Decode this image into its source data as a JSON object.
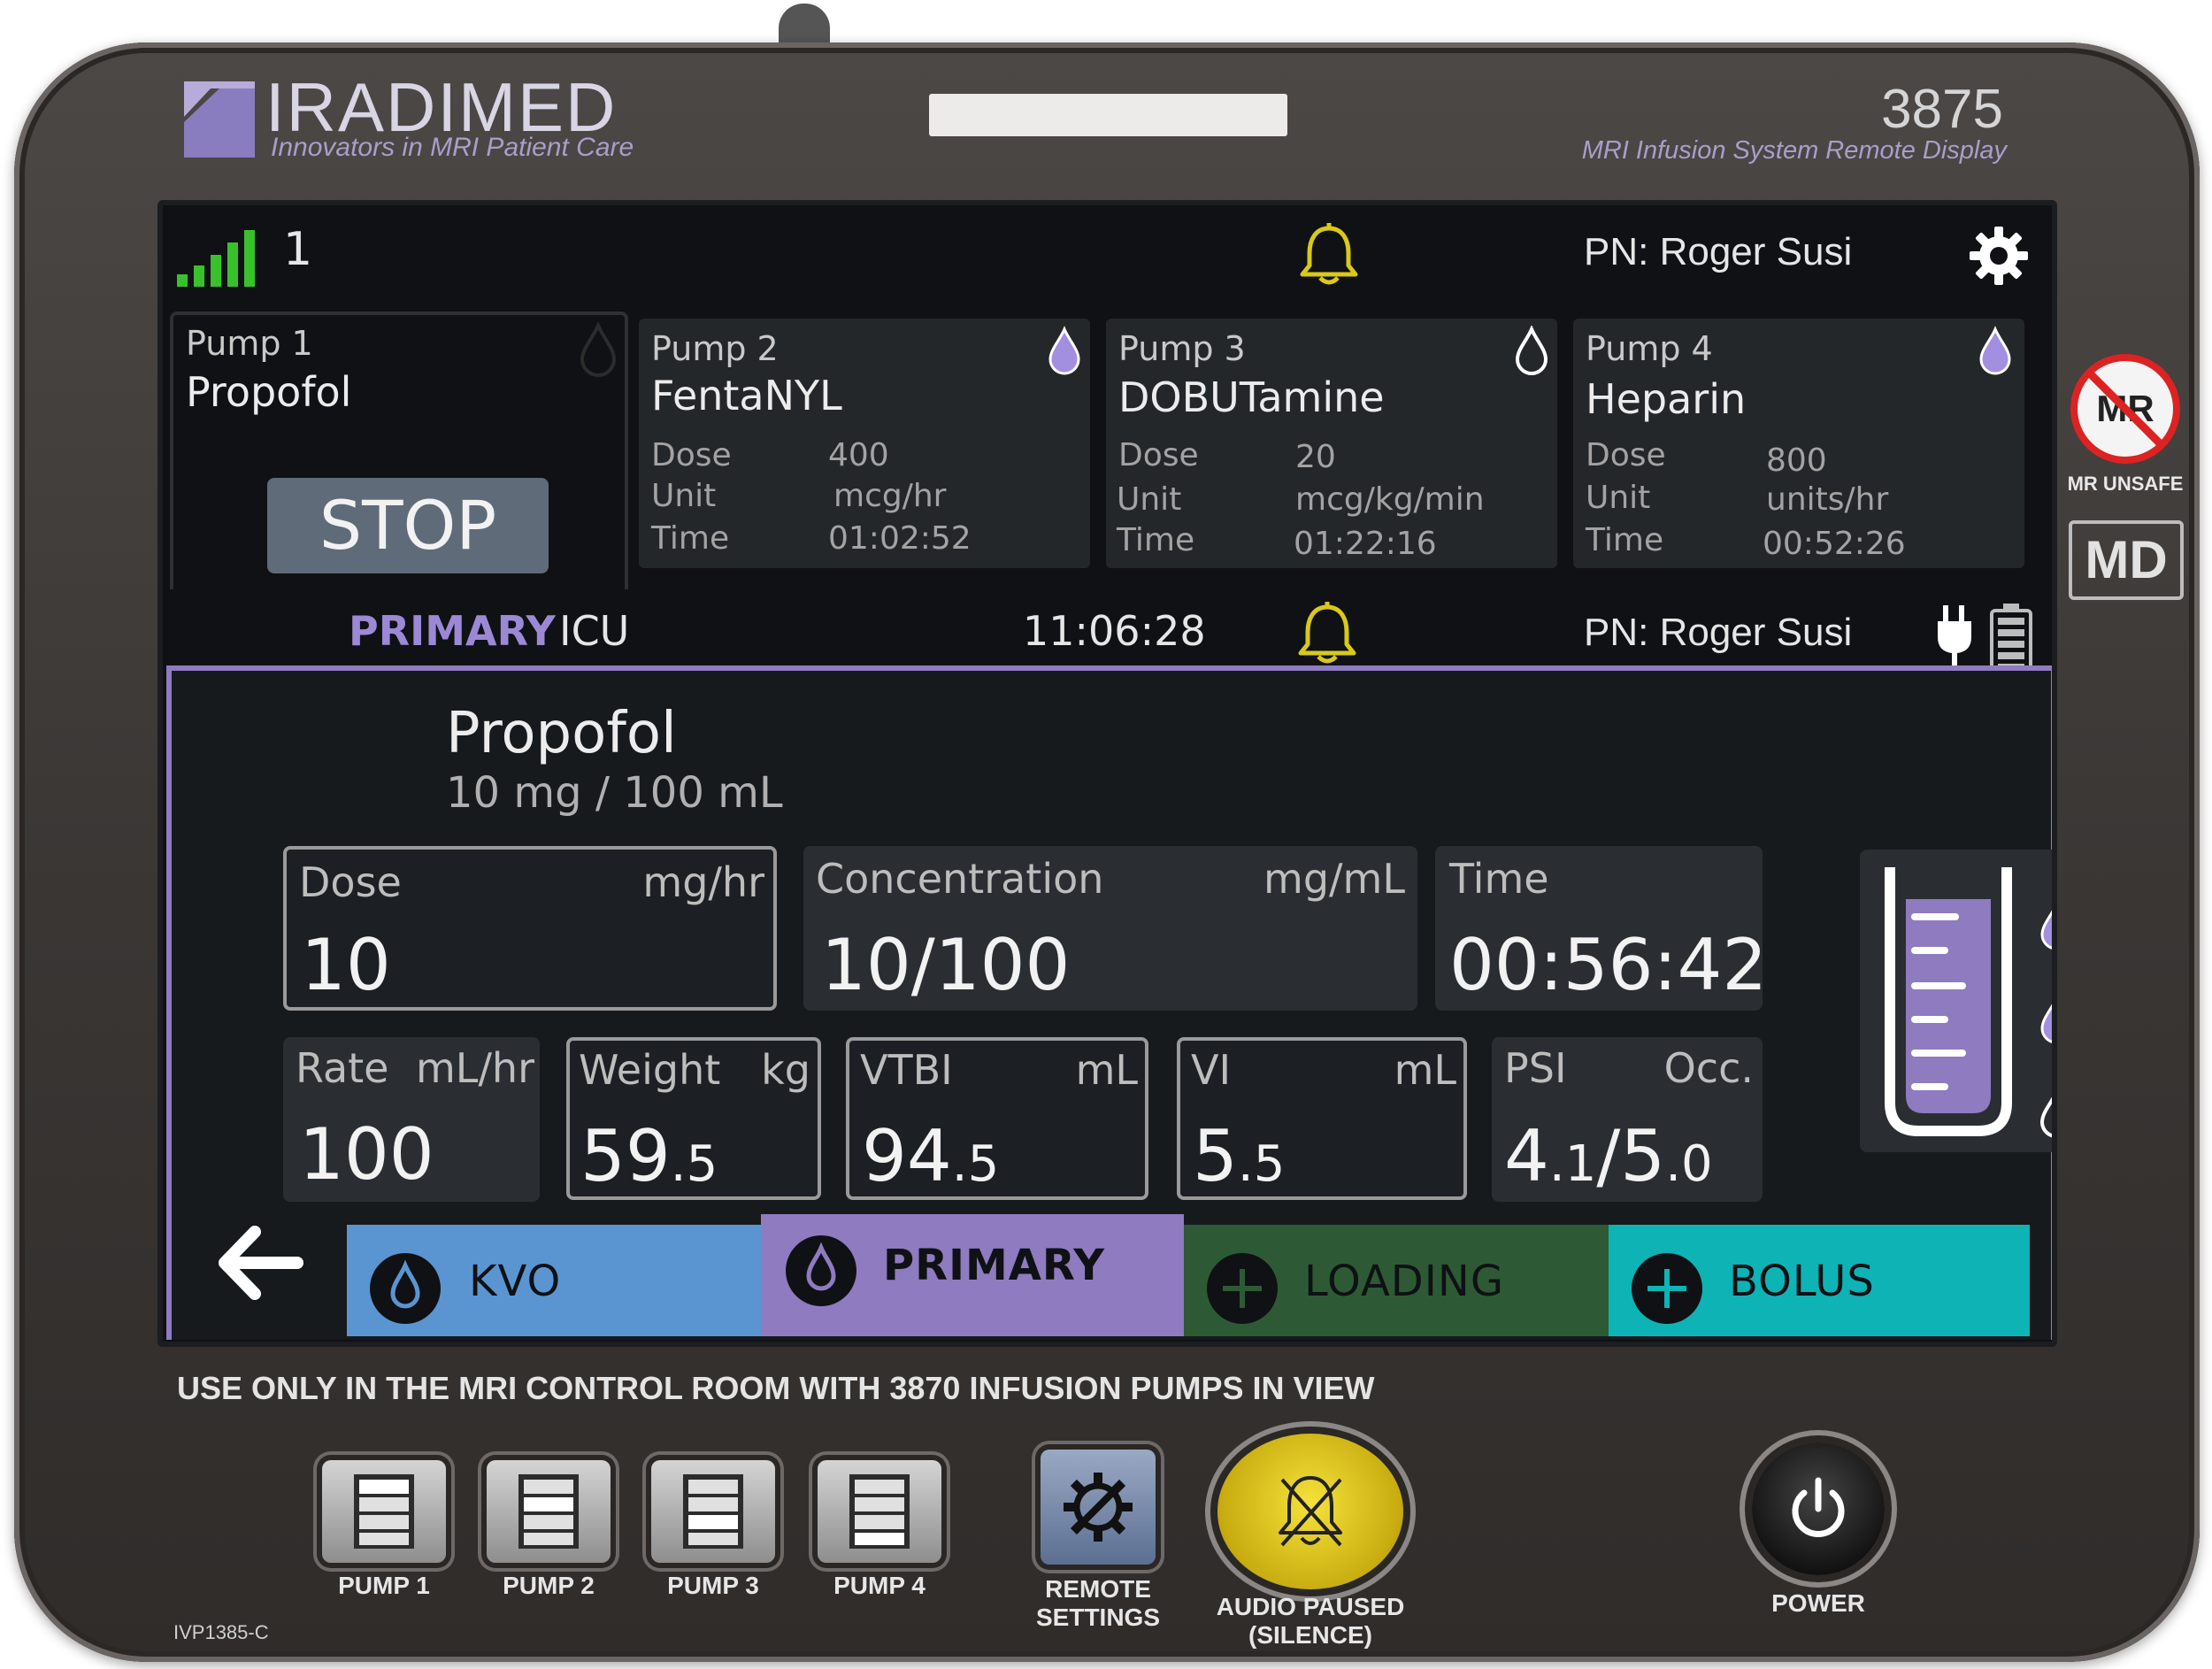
{
  "brand": {
    "name": "IRADIMED",
    "tagline": "Innovators in MRI Patient Care",
    "model_number": "3875",
    "model_description": "MRI Infusion System Remote Display"
  },
  "badges": {
    "mr_unsafe": "MR UNSAFE",
    "mr_symbol": "MR",
    "md": "MD"
  },
  "top_bar": {
    "channel": "1",
    "patient": "PN: Roger Susi",
    "signal_level": 5
  },
  "pumps": [
    {
      "title": "Pump 1",
      "drug": "Propofol",
      "action": "STOP"
    },
    {
      "title": "Pump 2",
      "drug": "FentaNYL",
      "rows": [
        {
          "label": "Dose",
          "value": "400"
        },
        {
          "label": "Unit",
          "value": "mcg/hr"
        },
        {
          "label": "Time",
          "value": "01:02:52"
        }
      ]
    },
    {
      "title": "Pump 3",
      "drug": "DOBUTamine",
      "rows": [
        {
          "label": "Dose",
          "value": "20"
        },
        {
          "label": "Unit",
          "value": "mcg/kg/min"
        },
        {
          "label": "Time",
          "value": "01:22:16"
        }
      ]
    },
    {
      "title": "Pump 4",
      "drug": "Heparin",
      "rows": [
        {
          "label": "Dose",
          "value": "800"
        },
        {
          "label": "Unit",
          "value": "units/hr"
        },
        {
          "label": "Time",
          "value": "00:52:26"
        }
      ]
    }
  ],
  "status_bar": {
    "mode": "PRIMARY",
    "unit": "ICU",
    "clock": "11:06:28",
    "patient": "PN: Roger Susi"
  },
  "main": {
    "drug": "Propofol",
    "concentration_text": "10 mg / 100 mL",
    "dose": {
      "label": "Dose",
      "unit": "mg/hr",
      "value": "10"
    },
    "concentration": {
      "label": "Concentration",
      "unit": "mg/mL",
      "value": "10/100"
    },
    "time": {
      "label": "Time",
      "value": "00:56:42"
    },
    "rate": {
      "label": "Rate",
      "unit": "mL/hr",
      "value": "100"
    },
    "weight": {
      "label": "Weight",
      "unit": "kg",
      "value_int": "59",
      "value_dec": ".5"
    },
    "vtbi": {
      "label": "VTBI",
      "unit": "mL",
      "value_int": "94",
      "value_dec": ".5"
    },
    "vi": {
      "label": "VI",
      "unit": "mL",
      "value_int": "5",
      "value_dec": ".5"
    },
    "psi": {
      "label": "PSI",
      "unit": "Occ.",
      "v1_int": "4",
      "v1_dec": ".1",
      "sep": "/",
      "v2_int": "5",
      "v2_dec": ".0"
    }
  },
  "tabs": [
    {
      "label": "KVO",
      "color": "#5a95d2"
    },
    {
      "label": "PRIMARY",
      "color": "#8f7bc0"
    },
    {
      "label": "LOADING",
      "color": "#2d5a35"
    },
    {
      "label": "BOLUS",
      "color": "#0db3b5"
    }
  ],
  "colors": {
    "accent_purple": "#8f7bc0",
    "bell_yellow": "#d9c919",
    "signal_green": "#39c12c"
  },
  "footer": {
    "warning": "USE ONLY IN THE MRI CONTROL ROOM WITH 3870 INFUSION PUMPS IN VIEW",
    "buttons": {
      "pump1": "PUMP 1",
      "pump2": "PUMP 2",
      "pump3": "PUMP 3",
      "pump4": "PUMP 4",
      "settings_line1": "REMOTE",
      "settings_line2": "SETTINGS",
      "audio_line1": "AUDIO PAUSED",
      "audio_line2": "(SILENCE)",
      "power": "POWER"
    },
    "part_number": "IVP1385-C"
  }
}
